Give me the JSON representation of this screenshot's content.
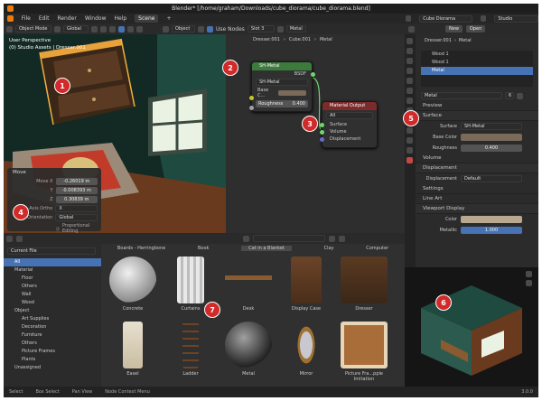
{
  "title": "Blender* [/home/graham/Downloads/cube_diorama/cube_diorama.blend]",
  "menu": [
    "File",
    "Edit",
    "Render",
    "Window",
    "Help"
  ],
  "workspace_tab": "Scene",
  "scene": {
    "name": "Cube Diorama",
    "view_layer": "Studio"
  },
  "toolbar": {
    "mode": "Object Mode",
    "orientation": "Global",
    "object": "Object",
    "use_nodes": "Use Nodes",
    "slot": "Slot 3",
    "material": "Metal"
  },
  "viewport": {
    "view_name": "User Perspective",
    "collection": "(0) Studio Assets | Dresser.001"
  },
  "operator": {
    "title": "Move",
    "move_x_label": "Move X",
    "move_x": "-0.26019 m",
    "y_label": "Y",
    "y": "-0.008393 m",
    "z_label": "Z",
    "z": "0.30839 m",
    "axis_ortho_label": "Axis Ortho",
    "axis_ortho": "X",
    "orientation_label": "Orientation",
    "orientation": "Global",
    "proportional": "Proportional Editing"
  },
  "node_breadcrumb": [
    "Dresser.001",
    "Cube.001",
    "Metal"
  ],
  "node_sh": {
    "title": "SH-Metal",
    "output": "BSDF",
    "group": "SH-Metal",
    "base_color": "Base C...",
    "roughness_label": "Roughness",
    "roughness": "0.400"
  },
  "node_output": {
    "title": "Material Output",
    "target": "All",
    "inputs": [
      "Surface",
      "Volume",
      "Displacement"
    ]
  },
  "props": {
    "breadcrumb_obj": "Dresser.001",
    "breadcrumb_mat": "Metal",
    "slots": [
      "Wood 1",
      "Wood 1",
      "Metal"
    ],
    "active_material": "Metal",
    "user_count": "6",
    "sections": {
      "preview": "Preview",
      "surface": "Surface",
      "volume": "Volume",
      "displacement": "Displacement",
      "settings": "Settings",
      "lineart": "Line Art",
      "viewport": "Viewport Display"
    },
    "surface_label": "Surface",
    "surface_value": "SH-Metal",
    "base_color_label": "Base Color",
    "roughness_label": "Roughness",
    "roughness_value": "0.400",
    "disp_label": "Displacement",
    "disp_value": "Default",
    "color_label": "Color",
    "metallic_label": "Metallic",
    "metallic_value": "1.000",
    "new_label": "New",
    "open_label": "Open"
  },
  "asset": {
    "library": "Current File",
    "tree": [
      "All",
      "Material",
      "Floor",
      "Others",
      "Wall",
      "Wood",
      "Object",
      "Art Supplies",
      "Decoration",
      "Furniture",
      "Others",
      "Picture Frames",
      "Plants",
      "Unassigned"
    ],
    "header_items": [
      "Boards - Herringbone",
      "Book",
      "Cat in a Blanket",
      "Clay",
      "Computer"
    ],
    "row1": [
      "Concrete",
      "Curtains",
      "Desk",
      "Display Case",
      "Dresser"
    ],
    "row2": [
      "Easel",
      "Ladder",
      "Metal",
      "Mirror",
      "Picture Fra...pple Imitation"
    ]
  },
  "status": [
    "Select",
    "Box Select",
    "Pan View",
    "Node Context Menu"
  ],
  "version": "3.0.0",
  "callouts": [
    "1",
    "2",
    "3",
    "4",
    "5",
    "6",
    "7"
  ],
  "colors": {
    "accent": "#4772b3",
    "callout": "#d12a2a",
    "node_header_green": "#3c7b3c",
    "node_header_red": "#7c2b2b"
  }
}
